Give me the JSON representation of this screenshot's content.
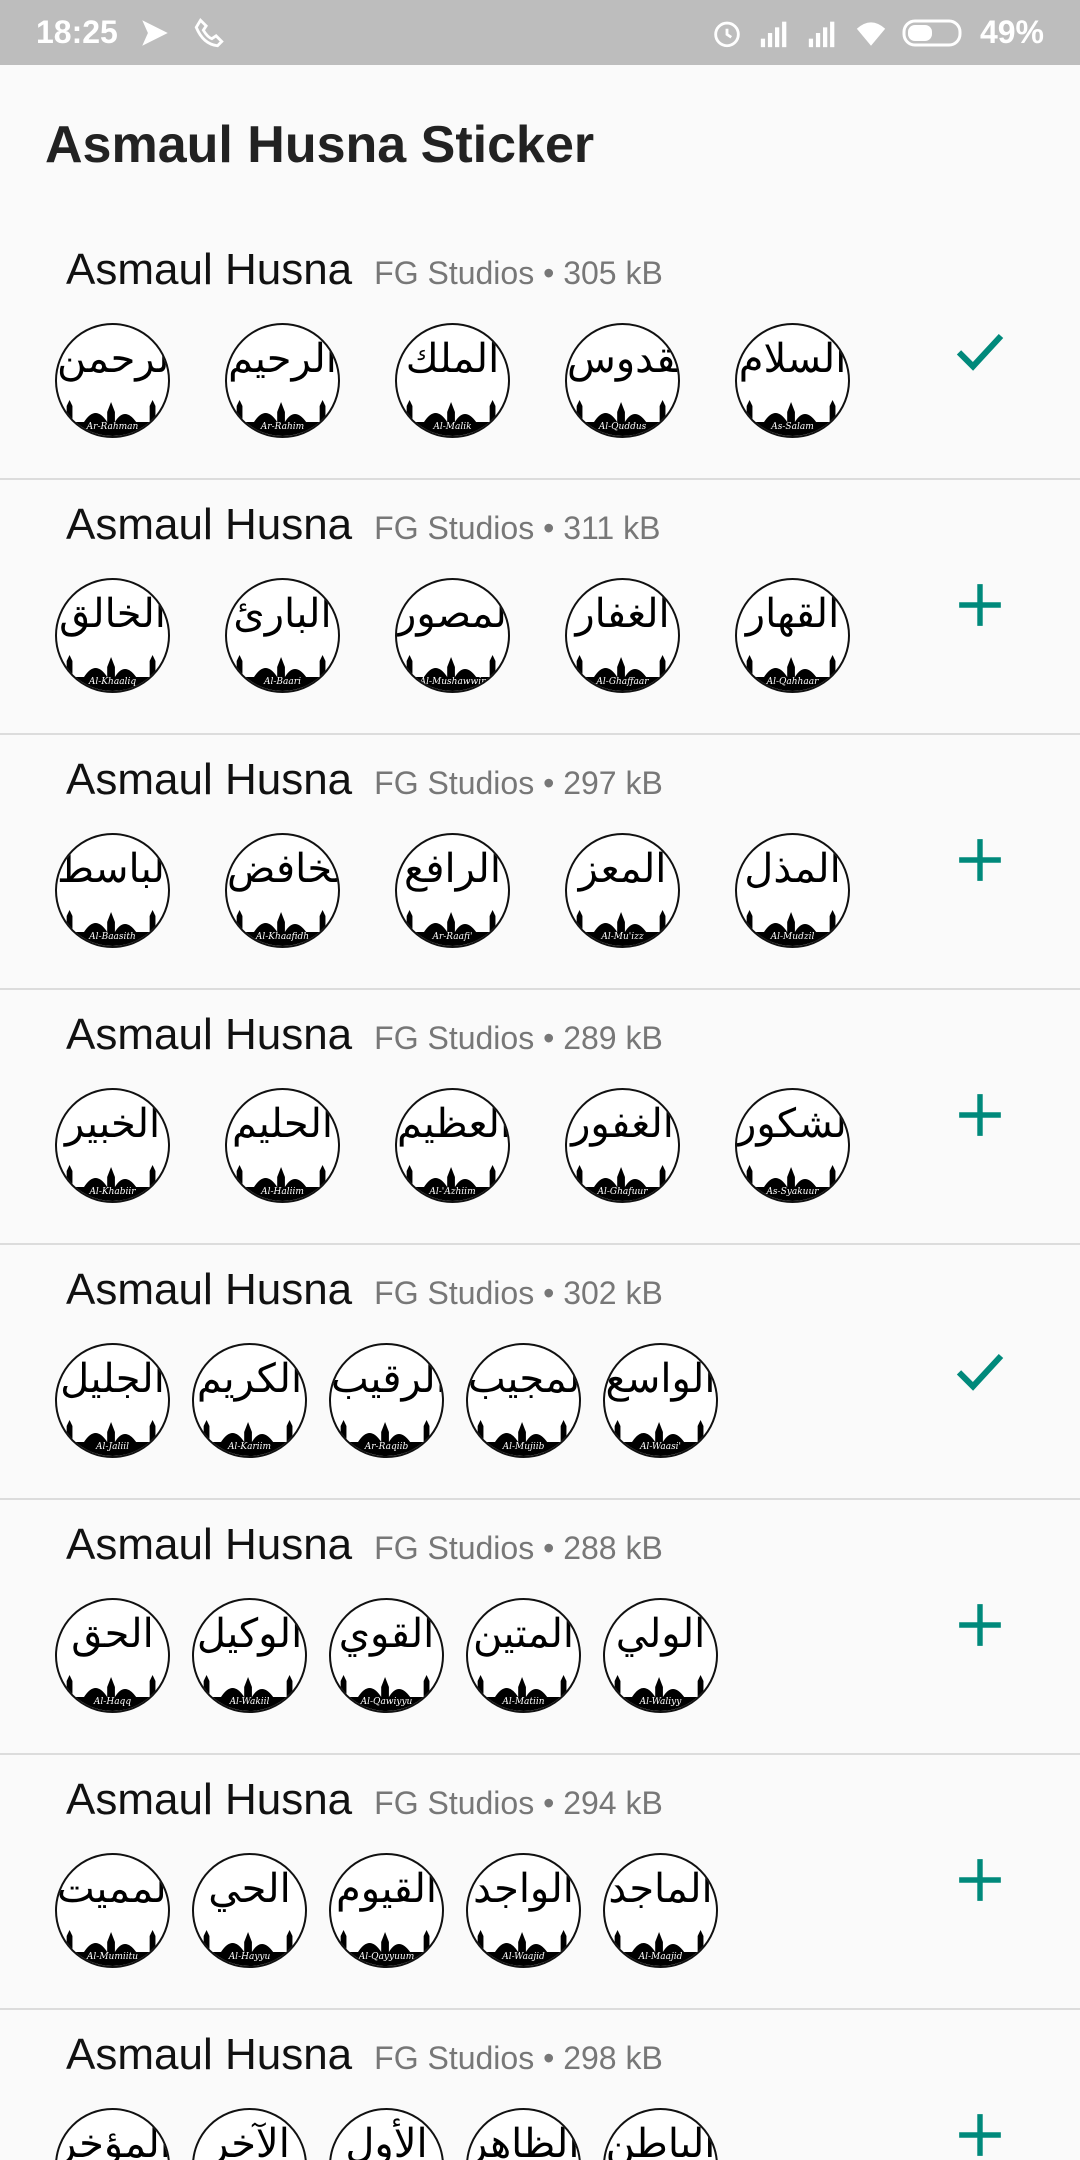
{
  "status_bar": {
    "time": "18:25",
    "battery": "49%",
    "icons": [
      "send-icon",
      "call-icon",
      "alarm-icon",
      "signal-icon",
      "signal-icon",
      "wifi-icon",
      "battery-icon"
    ]
  },
  "header": {
    "title": "Asmaul Husna Sticker"
  },
  "colors": {
    "accent": "#00897b"
  },
  "packs": [
    {
      "name": "Asmaul Husna",
      "publisher": "FG Studios",
      "size": "305 kB",
      "action": "check-icon",
      "stickers": [
        {
          "arabic": "الرحمن",
          "caption": "Ar-Rahman"
        },
        {
          "arabic": "الرحيم",
          "caption": "Ar-Rahim"
        },
        {
          "arabic": "الملك",
          "caption": "Al-Malik"
        },
        {
          "arabic": "القدوس",
          "caption": "Al-Quddus"
        },
        {
          "arabic": "السلام",
          "caption": "As-Salam"
        }
      ]
    },
    {
      "name": "Asmaul Husna",
      "publisher": "FG Studios",
      "size": "311 kB",
      "action": "plus-icon",
      "stickers": [
        {
          "arabic": "الخالق",
          "caption": "Al-Khaaliq"
        },
        {
          "arabic": "البارئ",
          "caption": "Al-Baari"
        },
        {
          "arabic": "المصور",
          "caption": "Al-Mushawwir"
        },
        {
          "arabic": "الغفار",
          "caption": "Al-Ghaffaar"
        },
        {
          "arabic": "القهار",
          "caption": "Al-Qahhaar"
        }
      ]
    },
    {
      "name": "Asmaul Husna",
      "publisher": "FG Studios",
      "size": "297 kB",
      "action": "plus-icon",
      "stickers": [
        {
          "arabic": "الباسط",
          "caption": "Al-Baasith"
        },
        {
          "arabic": "الخافض",
          "caption": "Al-Khaafidh"
        },
        {
          "arabic": "الرافع",
          "caption": "Ar-Raafi'"
        },
        {
          "arabic": "المعز",
          "caption": "Al-Mu'izz"
        },
        {
          "arabic": "المذل",
          "caption": "Al-Mudzil"
        }
      ]
    },
    {
      "name": "Asmaul Husna",
      "publisher": "FG Studios",
      "size": "289 kB",
      "action": "plus-icon",
      "stickers": [
        {
          "arabic": "الخبير",
          "caption": "Al-Khabiir"
        },
        {
          "arabic": "الحليم",
          "caption": "Al-Haliim"
        },
        {
          "arabic": "العظيم",
          "caption": "Al-'Azhiim"
        },
        {
          "arabic": "الغفور",
          "caption": "Al-Ghafuur"
        },
        {
          "arabic": "الشكور",
          "caption": "As-Syakuur"
        }
      ]
    },
    {
      "name": "Asmaul Husna",
      "publisher": "FG Studios",
      "size": "302 kB",
      "action": "check-icon",
      "stickers": [
        {
          "arabic": "الجليل",
          "caption": "Al-Jaliil"
        },
        {
          "arabic": "الكريم",
          "caption": "Al-Kariim"
        },
        {
          "arabic": "الرقيب",
          "caption": "Ar-Raqiib"
        },
        {
          "arabic": "المجيب",
          "caption": "Al-Mujiib"
        },
        {
          "arabic": "الواسع",
          "caption": "Al-Waasi'"
        }
      ]
    },
    {
      "name": "Asmaul Husna",
      "publisher": "FG Studios",
      "size": "288 kB",
      "action": "plus-icon",
      "stickers": [
        {
          "arabic": "الحق",
          "caption": "Al-Haqq"
        },
        {
          "arabic": "الوكيل",
          "caption": "Al-Wakiil"
        },
        {
          "arabic": "القوي",
          "caption": "Al-Qawiyyu"
        },
        {
          "arabic": "المتين",
          "caption": "Al-Matiin"
        },
        {
          "arabic": "الولي",
          "caption": "Al-Waliyy"
        }
      ]
    },
    {
      "name": "Asmaul Husna",
      "publisher": "FG Studios",
      "size": "294 kB",
      "action": "plus-icon",
      "stickers": [
        {
          "arabic": "المميت",
          "caption": "Al-Mumiitu"
        },
        {
          "arabic": "الحي",
          "caption": "Al-Hayyu"
        },
        {
          "arabic": "القيوم",
          "caption": "Al-Qayyuum"
        },
        {
          "arabic": "الواجد",
          "caption": "Al-Waajid"
        },
        {
          "arabic": "الماجد",
          "caption": "Al-Maajid"
        }
      ]
    },
    {
      "name": "Asmaul Husna",
      "publisher": "FG Studios",
      "size": "298 kB",
      "action": "plus-icon",
      "stickers": [
        {
          "arabic": "المؤخر",
          "caption": ""
        },
        {
          "arabic": "الآخر",
          "caption": ""
        },
        {
          "arabic": "الأول",
          "caption": ""
        },
        {
          "arabic": "الظاهر",
          "caption": ""
        },
        {
          "arabic": "الباطن",
          "caption": ""
        }
      ]
    }
  ]
}
